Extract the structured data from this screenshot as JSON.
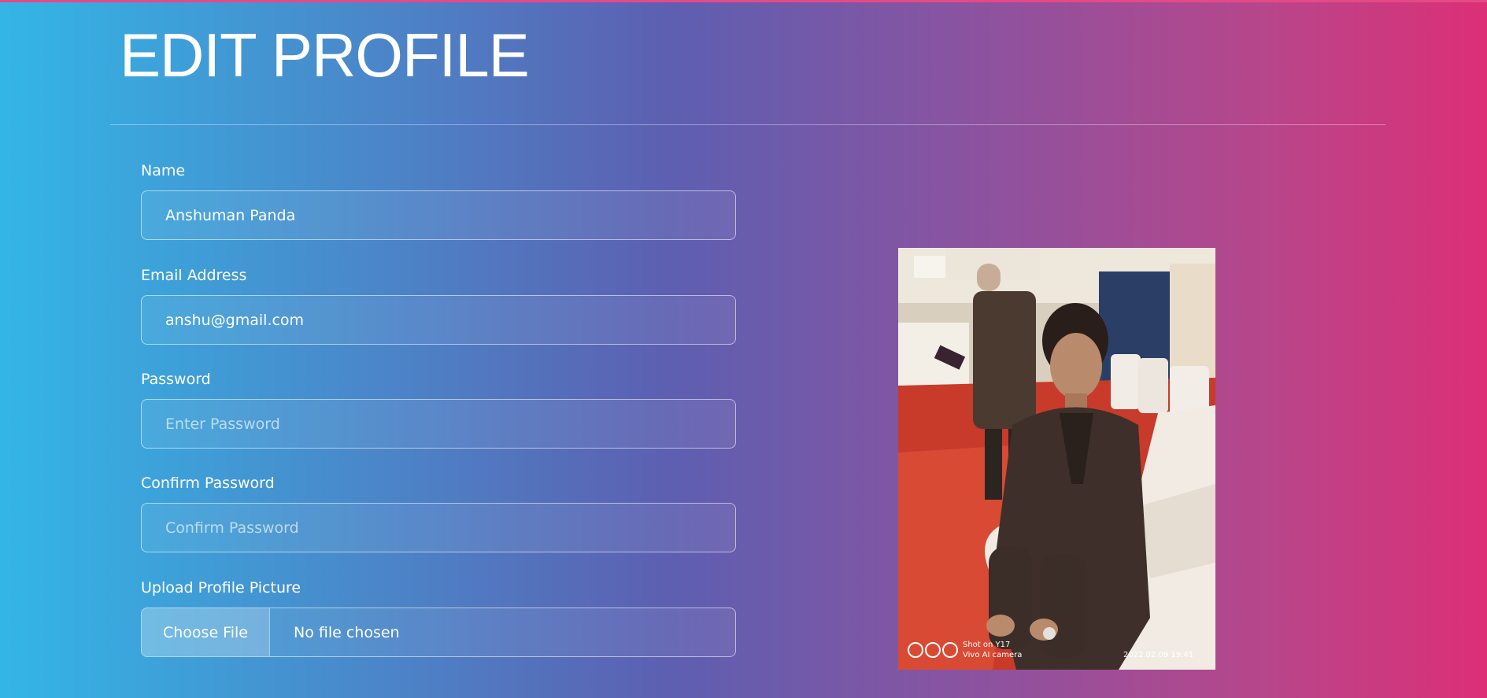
{
  "page": {
    "title": "EDIT PROFILE"
  },
  "form": {
    "name": {
      "label": "Name",
      "value": "Anshuman Panda"
    },
    "email": {
      "label": "Email Address",
      "value": "anshu@gmail.com"
    },
    "password": {
      "label": "Password",
      "placeholder": "Enter Password"
    },
    "confirm_password": {
      "label": "Confirm Password",
      "placeholder": "Confirm Password"
    },
    "upload": {
      "label": "Upload Profile Picture",
      "button_label": "Choose File",
      "status_text": "No file chosen"
    }
  },
  "photo": {
    "watermark_line1": "Shot on Y17",
    "watermark_line2": "Vivo AI camera",
    "timestamp": "2022.02.09 19:41"
  }
}
